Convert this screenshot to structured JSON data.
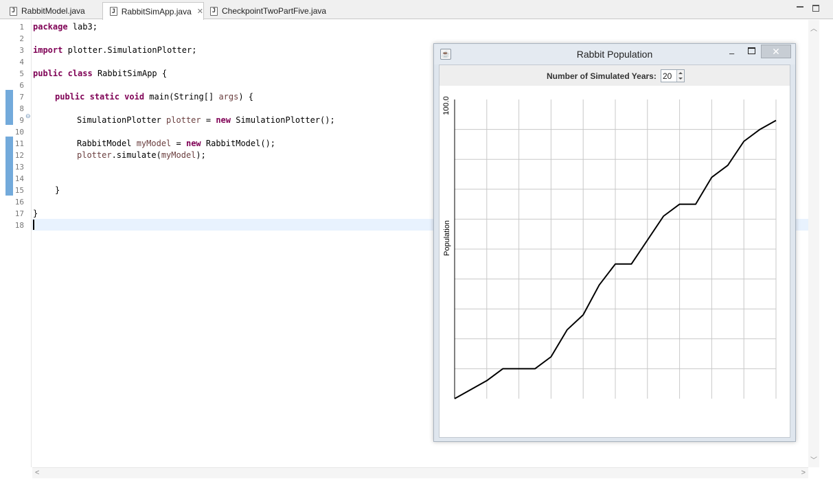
{
  "editor": {
    "tabs": [
      {
        "label": "RabbitModel.java",
        "active": false
      },
      {
        "label": "RabbitSimApp.java",
        "active": true
      },
      {
        "label": "CheckpointTwoPartFive.java",
        "active": false
      }
    ],
    "line_numbers": [
      "1",
      "2",
      "3",
      "4",
      "5",
      "6",
      "7",
      "8",
      "9",
      "10",
      "11",
      "12",
      "13",
      "14",
      "15",
      "16",
      "17",
      "18"
    ],
    "code": {
      "l1_kw": "package",
      "l1_rest": " lab3;",
      "l3_kw": "import",
      "l3_rest": " plotter.SimulationPlotter;",
      "l5_kw1": "public",
      "l5_kw2": " class",
      "l5_rest": " RabbitSimApp {",
      "l7_kw1": "public",
      "l7_kw2": " static",
      "l7_kw3": " void",
      "l7_rest": " main(String[] ",
      "l7_var": "args",
      "l7_end": ") {",
      "l9_type": "SimulationPlotter ",
      "l9_var": "plotter",
      "l9_mid": " = ",
      "l9_kw": "new",
      "l9_end": " SimulationPlotter();",
      "l11_type": "RabbitModel ",
      "l11_var": "myModel",
      "l11_mid": " = ",
      "l11_kw": "new",
      "l11_end": " RabbitModel();",
      "l12_var1": "plotter",
      "l12_mid": ".simulate(",
      "l12_var2": "myModel",
      "l12_end": ");",
      "l15": "}",
      "l17": "}"
    }
  },
  "dialog": {
    "title": "Rabbit Population",
    "control_label": "Number of Simulated Years:",
    "years_value": "20"
  },
  "chart_data": {
    "type": "line",
    "ylabel": "Population",
    "y_tick_label": "100.0",
    "ylim": [
      0,
      100
    ],
    "grid": true,
    "series": [
      {
        "values": [
          0,
          3,
          6,
          10,
          10,
          10,
          14,
          23,
          28,
          38,
          45,
          45,
          53,
          61,
          65,
          65,
          74,
          78,
          86,
          90,
          93
        ]
      }
    ]
  }
}
